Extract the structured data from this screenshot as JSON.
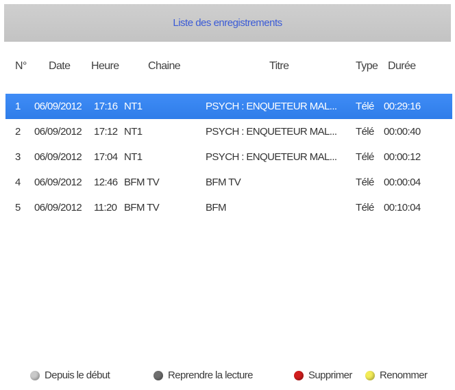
{
  "window": {
    "title": "Liste des enregistrements"
  },
  "columns": {
    "num": "N°",
    "date": "Date",
    "heure": "Heure",
    "chaine": "Chaine",
    "titre": "Titre",
    "type": "Type",
    "duree": "Durée"
  },
  "recordings": [
    {
      "num": "1",
      "date": "06/09/2012",
      "heure": "17:16",
      "chaine": "NT1",
      "titre": "PSYCH : ENQUETEUR MAL...",
      "type": "Télé",
      "duree": "00:29:16",
      "selected": true
    },
    {
      "num": "2",
      "date": "06/09/2012",
      "heure": "17:12",
      "chaine": "NT1",
      "titre": "PSYCH : ENQUETEUR MAL...",
      "type": "Télé",
      "duree": "00:00:40"
    },
    {
      "num": "3",
      "date": "06/09/2012",
      "heure": "17:04",
      "chaine": "NT1",
      "titre": "PSYCH : ENQUETEUR MAL...",
      "type": "Télé",
      "duree": "00:00:12"
    },
    {
      "num": "4",
      "date": "06/09/2012",
      "heure": "12:46",
      "chaine": "BFM TV",
      "titre": "BFM TV",
      "type": "Télé",
      "duree": "00:00:04"
    },
    {
      "num": "5",
      "date": "06/09/2012",
      "heure": "11:20",
      "chaine": "BFM TV",
      "titre": "BFM",
      "type": "Télé",
      "duree": "00:10:04"
    }
  ],
  "footer": {
    "from_start": {
      "label": "Depuis le début",
      "color": "#c9c9c9",
      "icon": "grey-button-icon"
    },
    "resume": {
      "label": "Reprendre la lecture",
      "color": "#6f6f6f",
      "icon": "dark-grey-button-icon"
    },
    "delete": {
      "label": "Supprimer",
      "color": "#d11d1d",
      "icon": "red-button-icon"
    },
    "rename": {
      "label": "Renommer",
      "color": "#f3ec58",
      "icon": "yellow-button-icon"
    }
  },
  "colors": {
    "selection": "#3a86f2",
    "title_text": "#3b5bd6",
    "title_bar": "#c9c9c9"
  }
}
